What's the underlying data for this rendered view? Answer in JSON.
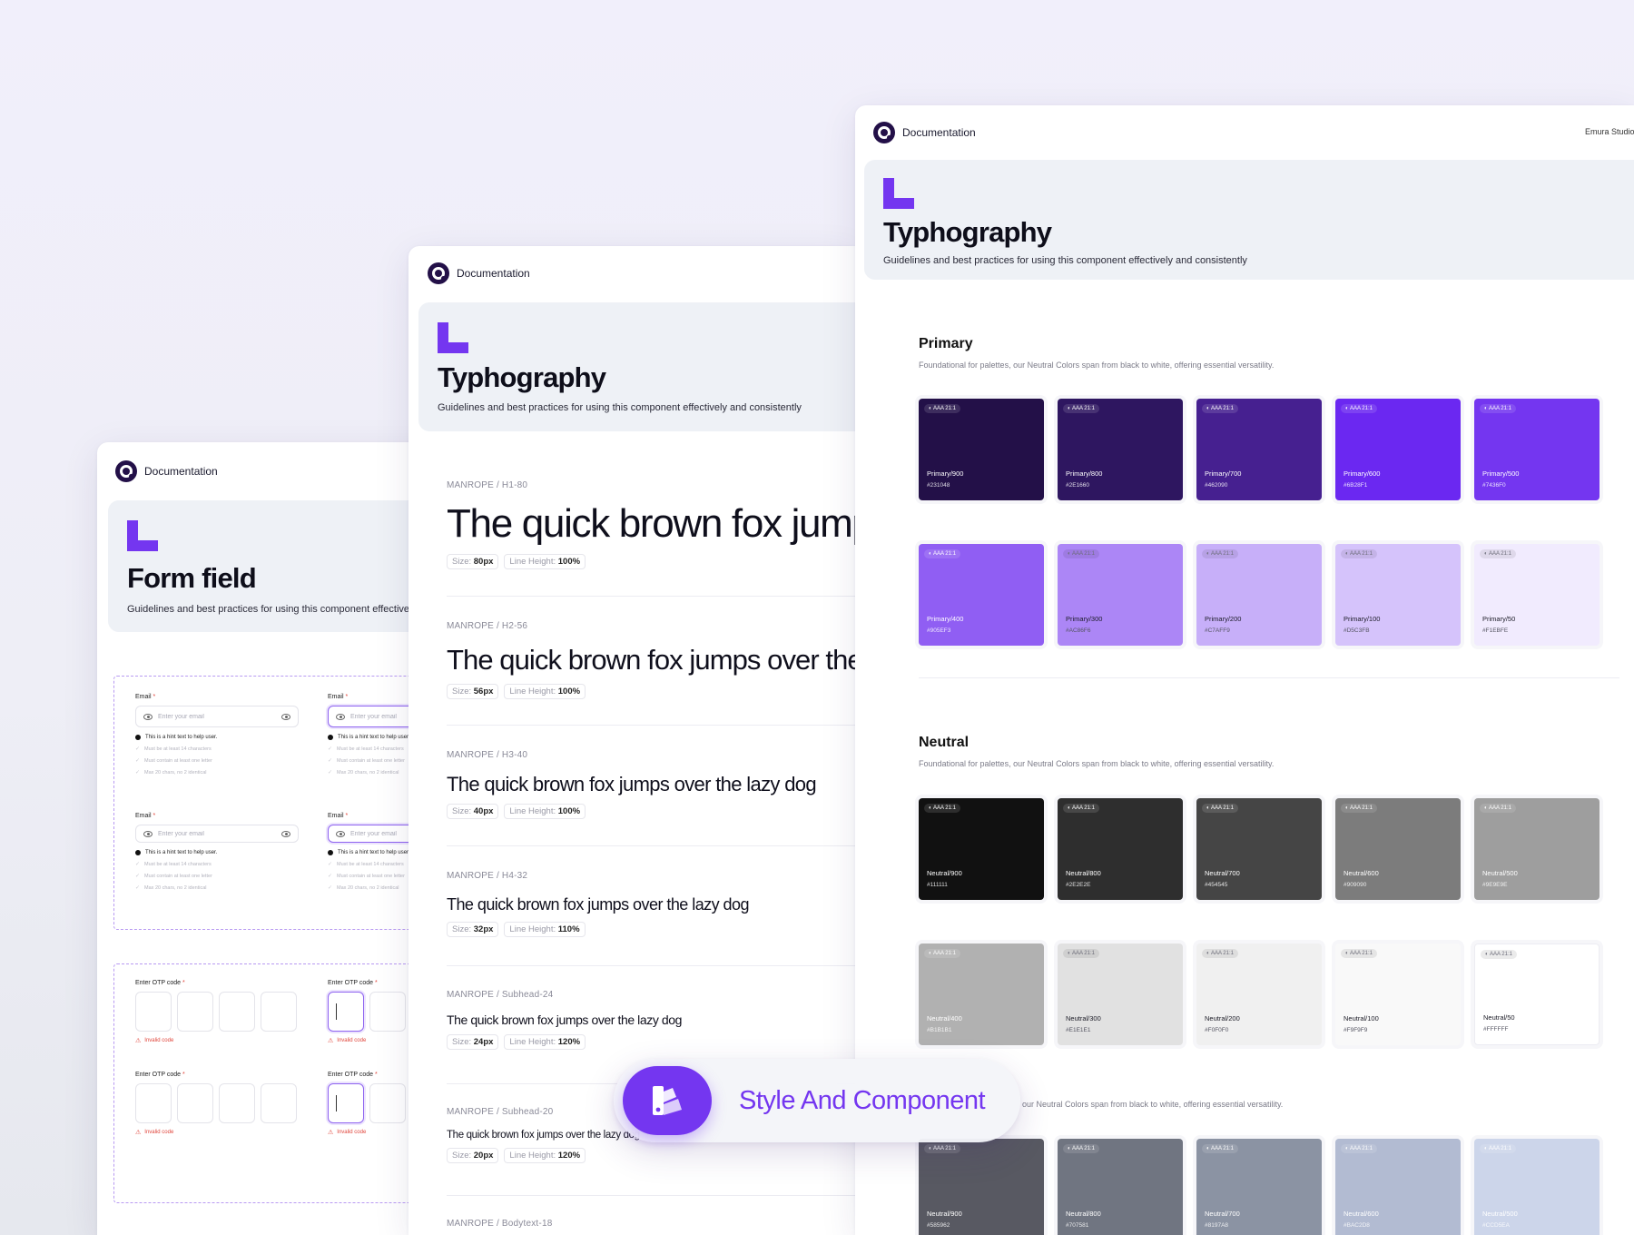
{
  "brand": {
    "accent": "#7436f0",
    "logo_color": "#231048"
  },
  "form_card": {
    "doc_title": "Documentation",
    "title": "Form field",
    "subtitle": "Guidelines and best practices for using this component effectively and consistently",
    "email_label": "Email",
    "required_mark": "*",
    "email_placeholder": "Enter your email",
    "hint": "This is a hint text to help user.",
    "rules": [
      "Must be at least 14 characters",
      "Must contain at least one letter",
      "Max 20 chars, no 2 identical"
    ],
    "otp_label": "Enter OTP code",
    "otp_error": "Invalid code"
  },
  "type_card": {
    "doc_title": "Documentation",
    "title": "Typhography",
    "subtitle": "Guidelines and best practices for using this component effectively and consistently",
    "sample": "The quick brown fox jumps over the lazy dog",
    "size_label": "Size:",
    "lh_label": "Line Height:",
    "styles": [
      {
        "name": "MANROPE / H1-80",
        "size": "80px",
        "lh": "100%"
      },
      {
        "name": "MANROPE / H2-56",
        "size": "56px",
        "lh": "100%"
      },
      {
        "name": "MANROPE / H3-40",
        "size": "40px",
        "lh": "100%"
      },
      {
        "name": "MANROPE / H4-32",
        "size": "32px",
        "lh": "110%"
      },
      {
        "name": "MANROPE / Subhead-24",
        "size": "24px",
        "lh": "120%"
      },
      {
        "name": "MANROPE / Subhead-20",
        "size": "20px",
        "lh": "120%"
      },
      {
        "name": "MANROPE / Bodytext-18"
      }
    ]
  },
  "color_card": {
    "doc_title": "Documentation",
    "studio": "Emura Studio",
    "title": "Typhography",
    "subtitle": "Guidelines and best practices for using this component effectively and consistently",
    "badge": "AAA 21:1",
    "section_desc": "Foundational for palettes, our Neutral Colors span from black to white, offering essential versatility.",
    "section_desc_partial": "our Neutral Colors span from black to white, offering essential versatility.",
    "primary": {
      "title": "Primary",
      "swatches": [
        {
          "name": "Primary/900",
          "hex": "#231048",
          "color": "#231048",
          "dark_text": false
        },
        {
          "name": "Primary/800",
          "hex": "#2E1660",
          "color": "#2e1660",
          "dark_text": false
        },
        {
          "name": "Primary/700",
          "hex": "#462090",
          "color": "#462090",
          "dark_text": false
        },
        {
          "name": "Primary/600",
          "hex": "#6B28F1",
          "color": "#6b28f1",
          "dark_text": false
        },
        {
          "name": "Primary/500",
          "hex": "#7436F0",
          "color": "#7436f0",
          "dark_text": false
        },
        {
          "name": "Primary/400",
          "hex": "#905EF3",
          "color": "#905ef3",
          "dark_text": false
        },
        {
          "name": "Primary/300",
          "hex": "#AC86F6",
          "color": "#ac86f6",
          "dark_text": true
        },
        {
          "name": "Primary/200",
          "hex": "#C7AFF9",
          "color": "#c7aff9",
          "dark_text": true
        },
        {
          "name": "Primary/100",
          "hex": "#D5C3FB",
          "color": "#d5c3fb",
          "dark_text": true
        },
        {
          "name": "Primary/50",
          "hex": "#F1EBFE",
          "color": "#f1ebfe",
          "dark_text": true
        }
      ]
    },
    "neutral": {
      "title": "Neutral",
      "swatches": [
        {
          "name": "Neutral/900",
          "hex": "#111111",
          "color": "#111111",
          "dark_text": false
        },
        {
          "name": "Neutral/800",
          "hex": "#2E2E2E",
          "color": "#2e2e2e",
          "dark_text": false
        },
        {
          "name": "Neutral/700",
          "hex": "#454545",
          "color": "#454545",
          "dark_text": false
        },
        {
          "name": "Neutral/600",
          "hex": "#909090",
          "color": "#7c7c7c",
          "dark_text": false
        },
        {
          "name": "Neutral/500",
          "hex": "#9E9E9E",
          "color": "#9e9e9e",
          "dark_text": false
        },
        {
          "name": "Neutral/400",
          "hex": "#B1B1B1",
          "color": "#b1b1b1",
          "dark_text": false
        },
        {
          "name": "Neutral/300",
          "hex": "#E1E1E1",
          "color": "#e1e1e1",
          "dark_text": true
        },
        {
          "name": "Neutral/200",
          "hex": "#F0F0F0",
          "color": "#f0f0f0",
          "dark_text": true
        },
        {
          "name": "Neutral/100",
          "hex": "#F9F9F9",
          "color": "#f9f9f9",
          "dark_text": true
        },
        {
          "name": "Neutral/50",
          "hex": "#FFFFFF",
          "color": "#ffffff",
          "dark_text": true
        }
      ]
    },
    "cool": {
      "swatches": [
        {
          "name": "Neutral/900",
          "hex": "#585962",
          "color": "#585962",
          "dark_text": false
        },
        {
          "name": "Neutral/800",
          "hex": "#707581",
          "color": "#707581",
          "dark_text": false
        },
        {
          "name": "Neutral/700",
          "hex": "#8197A8",
          "color": "#8b93a3",
          "dark_text": false
        },
        {
          "name": "Neutral/600",
          "hex": "#BAC2D8",
          "color": "#b2bbd2",
          "dark_text": false
        },
        {
          "name": "Neutral/500",
          "hex": "#CCD5EA",
          "color": "#ccd5ea",
          "dark_text": false
        }
      ]
    }
  },
  "pill": {
    "label": "Style And Component"
  }
}
